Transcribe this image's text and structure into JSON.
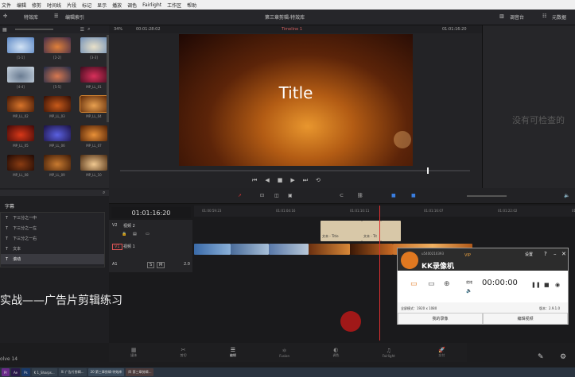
{
  "menu": [
    "文件",
    "编辑",
    "修剪",
    "时间线",
    "片段",
    "标记",
    "显示",
    "播放",
    "调色",
    "Fairlight",
    "工作区",
    "帮助"
  ],
  "toolbar": {
    "media_pool": "特效库",
    "edit_index": "编辑索引",
    "project_title": "第三章剪辑-特效库",
    "mixer": "调音台",
    "metadata": "元数据",
    "zoom": "34%",
    "timecode_left": "00:01:28:02",
    "timeline_name": "Timeline 1",
    "timecode_right": "01:01:16:20"
  },
  "media": [
    {
      "label": "[1-1]",
      "c1": "#5a86c4",
      "c2": "#d2e2f4"
    },
    {
      "label": "[2-2]",
      "c1": "#3d2a4a",
      "c2": "#e0803a"
    },
    {
      "label": "[3-3]",
      "c1": "#6f8fb8",
      "c2": "#e8e0c8"
    },
    {
      "label": "[4-4]",
      "c1": "#c8d4e0",
      "c2": "#6a7c92"
    },
    {
      "label": "[5-5]",
      "c1": "#1e2a48",
      "c2": "#d87850"
    },
    {
      "label": "MP_LL_01",
      "c1": "#3a0a1c",
      "c2": "#d8305a"
    },
    {
      "label": "MP_LL_02",
      "c1": "#3a1204",
      "c2": "#d8742a"
    },
    {
      "label": "MP_LL_03",
      "c1": "#2e0c04",
      "c2": "#c85a1a"
    },
    {
      "label": "MP_LL_04",
      "c1": "#5a2606",
      "c2": "#e8a050"
    },
    {
      "label": "MP_LL_05",
      "c1": "#3c0808",
      "c2": "#d83818"
    },
    {
      "label": "MP_LL_06",
      "c1": "#1a1040",
      "c2": "#5a60e0"
    },
    {
      "label": "MP_LL_07",
      "c1": "#4a1c04",
      "c2": "#e89038"
    },
    {
      "label": "MP_LL_08",
      "c1": "#1c0804",
      "c2": "#8a3c12"
    },
    {
      "label": "MP_LL_09",
      "c1": "#3a1806",
      "c2": "#c87a30"
    },
    {
      "label": "MP_LL_10",
      "c1": "#4a2a10",
      "c2": "#f0c890"
    }
  ],
  "viewer": {
    "title_text": "Title"
  },
  "right_panel": {
    "empty_text": "没有可检查的"
  },
  "effects": {
    "header": "字幕",
    "items": [
      "下三分之一中",
      "下三分之一左",
      "下三分之一右",
      "文本",
      "滚动"
    ],
    "selected_index": 4
  },
  "timeline": {
    "timecode": "01:01:16:20",
    "ruler": [
      "01:00:59:23",
      "01:01:04:16",
      "01:01:10:11",
      "01:01:16:07",
      "01:01:22:02",
      "01:01:25:21"
    ],
    "v2": {
      "id": "V2",
      "name": "视频 2"
    },
    "v1": {
      "id": "V1",
      "name": "视频 1"
    },
    "a1": {
      "id": "A1",
      "s": "S",
      "m": "M",
      "level": "2.0"
    },
    "clip_titles": [
      "文本 - Title",
      "文本 - Tit"
    ]
  },
  "overlay_caption": "实战——广告片剪辑练习",
  "kk": {
    "app_name": "KK录像机",
    "version_tag": "VIP",
    "settings": "设置",
    "user": "u5400210393",
    "time": "00:00:00",
    "status_label": "就绪",
    "size_label": "全屏模式：1920 x 1080",
    "version": "版本：2.9.1.0",
    "btn_left": "我的录像",
    "btn_right": "编辑视频"
  },
  "pages": [
    "媒体",
    "剪切",
    "编辑",
    "Fusion",
    "调色",
    "Fairlight",
    "交付"
  ],
  "app_version": "olve 14",
  "taskbar": [
    "Pr",
    "Ae",
    "Ps",
    "K 1_Sharps...",
    "Xi 广告片剪辑...",
    "20 第三章剪辑-特效库",
    "四 第三章剪辑..."
  ]
}
